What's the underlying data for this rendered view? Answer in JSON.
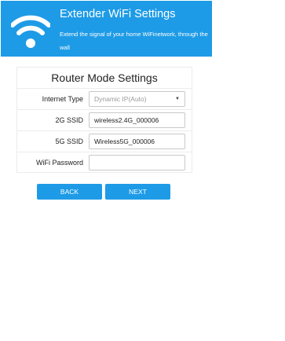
{
  "header": {
    "title": "Extender WiFi Settings",
    "subtitle": "Extend the signal of your home WiFinetwork, through the wall",
    "icon": "wifi-icon",
    "background": "#1e9be6"
  },
  "panel": {
    "title": "Router Mode Settings",
    "rows": {
      "internet_type": {
        "label": "Internet Type",
        "selected": "Dynamic IP(Auto)"
      },
      "ssid_2g": {
        "label": "2G SSID",
        "value": "wireless2.4G_000006"
      },
      "ssid_5g": {
        "label": "5G SSID",
        "value": "Wireless5G_000006"
      },
      "wifi_password": {
        "label": "WiFi Password",
        "value": ""
      }
    }
  },
  "buttons": {
    "back": "BACK",
    "next": "NEXT",
    "color": "#1e9be6"
  }
}
